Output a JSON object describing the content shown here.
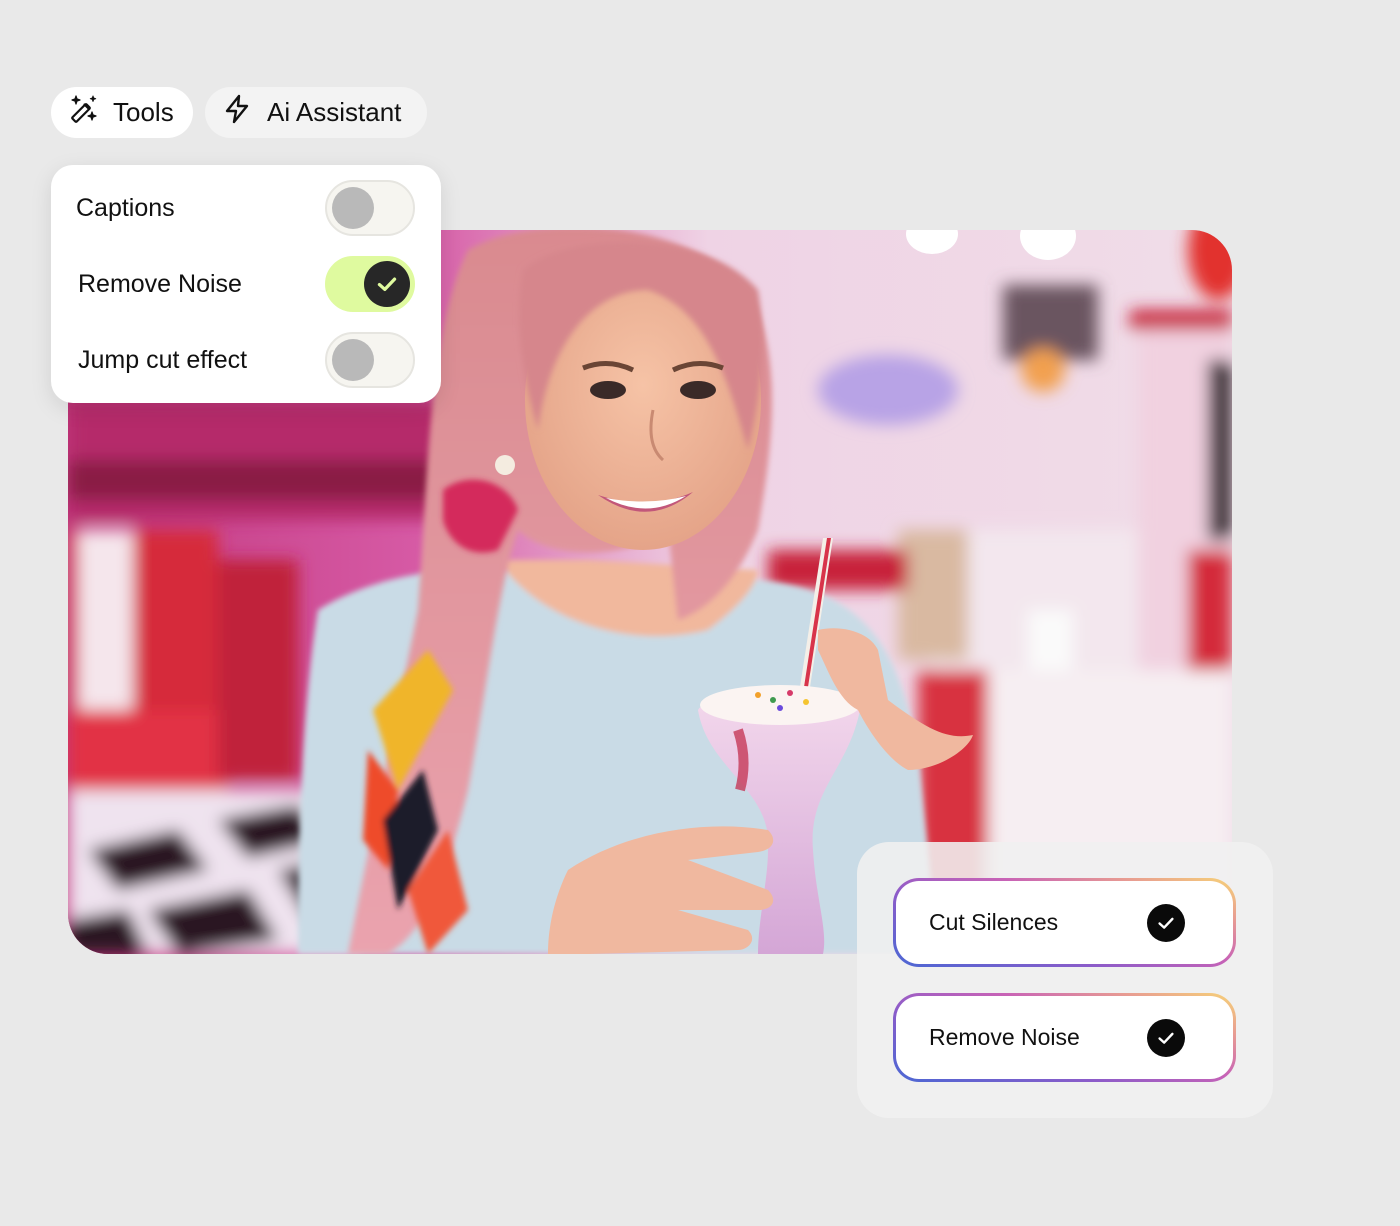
{
  "toolbar": {
    "tools": {
      "label": "Tools",
      "icon": "magic-wand-icon"
    },
    "ai_assistant": {
      "label": "Ai Assistant",
      "icon": "lightning-icon"
    }
  },
  "settings": {
    "items": [
      {
        "label": "Captions",
        "enabled": false
      },
      {
        "label": "Remove Noise",
        "enabled": true
      },
      {
        "label": "Jump cut effect",
        "enabled": false
      }
    ]
  },
  "actions": {
    "items": [
      {
        "label": "Cut Silences",
        "checked": true,
        "icon": "check-circle-icon"
      },
      {
        "label": "Remove Noise",
        "checked": true,
        "icon": "check-circle-icon"
      }
    ]
  },
  "media": {
    "subject": "Woman with pink hair holding a milkshake in a retro diner"
  },
  "colors": {
    "background": "#e9e9e9",
    "toggle_on": "#dffa9f",
    "toggle_knob_on": "#272727",
    "toggle_off_track": "#f6f5f0",
    "toggle_off_knob": "#b9b9b9",
    "gradient_border": [
      "#4a67d4",
      "#8d5cc9",
      "#c863b6",
      "#e79a93",
      "#f7d477"
    ]
  }
}
